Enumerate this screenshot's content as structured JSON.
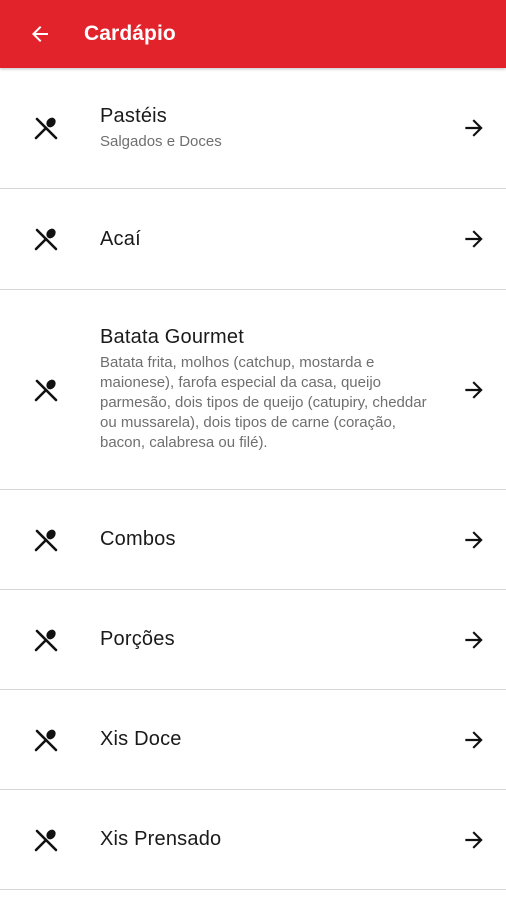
{
  "appbar": {
    "title": "Cardápio",
    "back_icon": "arrow-left-icon",
    "color": "#e3232b"
  },
  "items": [
    {
      "title": "Pastéis",
      "subtitle": "Salgados e Doces",
      "icon": "fork-spoon-icon",
      "trailing_icon": "arrow-right-icon"
    },
    {
      "title": "Acaí",
      "subtitle": "",
      "icon": "fork-spoon-icon",
      "trailing_icon": "arrow-right-icon"
    },
    {
      "title": "Batata Gourmet",
      "subtitle": "Batata frita, molhos (catchup, mostarda e maionese), farofa especial da casa, queijo parmesão, dois tipos de queijo (catupiry, cheddar ou mussarela), dois tipos de carne (coração, bacon, calabresa ou filé).",
      "icon": "fork-spoon-icon",
      "trailing_icon": "arrow-right-icon"
    },
    {
      "title": "Combos",
      "subtitle": "",
      "icon": "fork-spoon-icon",
      "trailing_icon": "arrow-right-icon"
    },
    {
      "title": "Porções",
      "subtitle": "",
      "icon": "fork-spoon-icon",
      "trailing_icon": "arrow-right-icon"
    },
    {
      "title": "Xis Doce",
      "subtitle": "",
      "icon": "fork-spoon-icon",
      "trailing_icon": "arrow-right-icon"
    },
    {
      "title": "Xis Prensado",
      "subtitle": "",
      "icon": "fork-spoon-icon",
      "trailing_icon": "arrow-right-icon"
    }
  ]
}
